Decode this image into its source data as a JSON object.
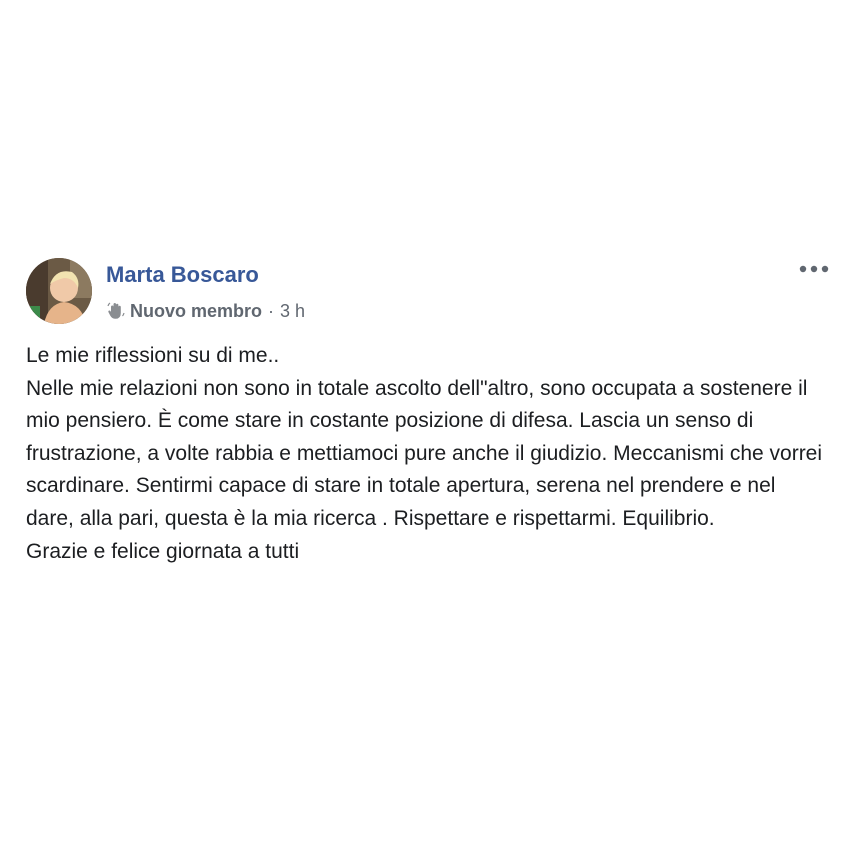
{
  "author": {
    "name": "Marta Boscaro",
    "badge": "Nuovo membro",
    "badge_icon": "waving-hand-icon",
    "time": "3 h"
  },
  "menu": {
    "icon": "more-options-icon"
  },
  "post": {
    "lines": [
      "Le mie riflessioni su di me..",
      "Nelle mie relazioni non sono in totale ascolto dell\"altro, sono occupata a sostenere il mio pensiero. È come stare in costante posizione di difesa. Lascia un senso di frustrazione, a volte rabbia e mettiamoci pure anche il giudizio. Meccanismi che vorrei scardinare. Sentirmi capace di stare in totale apertura, serena nel prendere e nel dare, alla pari, questa è la mia ricerca . Rispettare e rispettarmi. Equilibrio.",
      "Grazie e felice giornata a tutti"
    ]
  },
  "colors": {
    "name": "#385898",
    "meta": "#606770",
    "text": "#1c1e21"
  }
}
